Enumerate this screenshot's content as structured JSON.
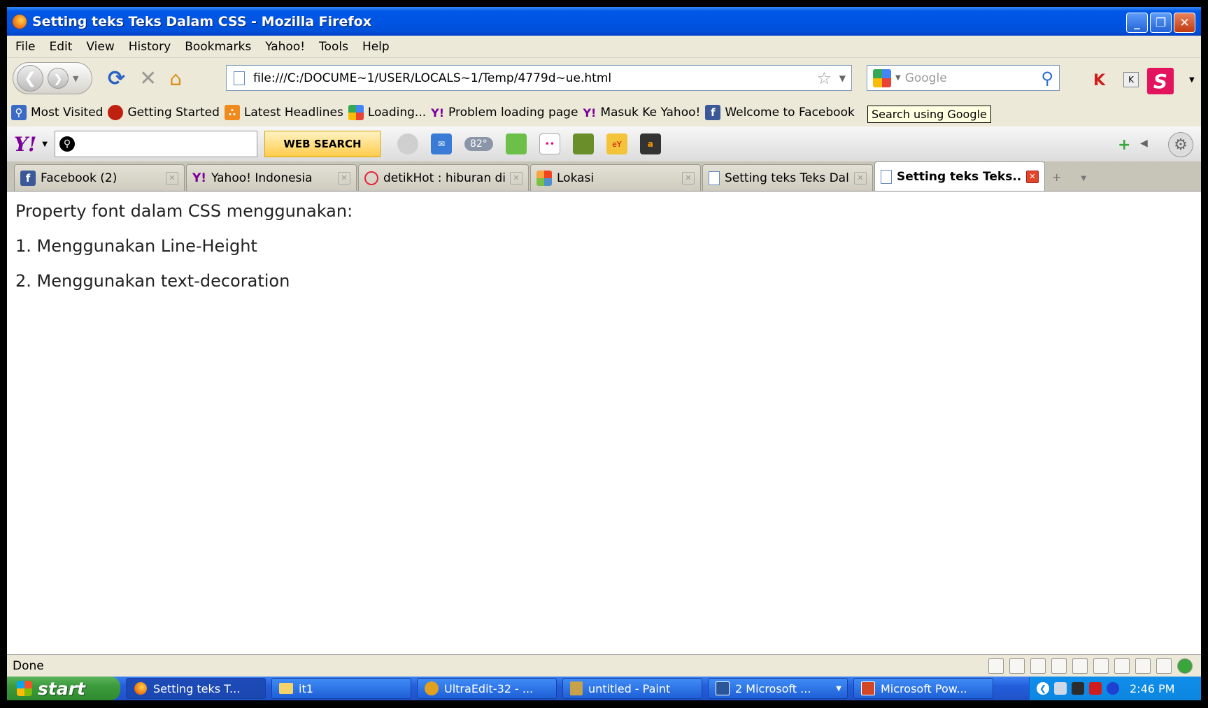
{
  "window": {
    "title": "Setting teks Teks Dalam CSS - Mozilla Firefox",
    "minimize": "_",
    "maximize": "❐",
    "close": "✕"
  },
  "menu": [
    "File",
    "Edit",
    "View",
    "History",
    "Bookmarks",
    "Yahoo!",
    "Tools",
    "Help"
  ],
  "nav": {
    "url": "file:///C:/DOCUME~1/USER/LOCALS~1/Temp/4779d~ue.html",
    "search_placeholder": "Google"
  },
  "bookmarks": [
    {
      "label": "Most Visited",
      "icon": "most-visited-icon",
      "color": "#3b6bc6"
    },
    {
      "label": "Getting Started",
      "icon": "firefox-red-icon",
      "color": "#c0200f"
    },
    {
      "label": "Latest Headlines",
      "icon": "rss-icon",
      "color": "#f08a1c"
    },
    {
      "label": "Loading...",
      "icon": "google-icon",
      "color": "#4285f4"
    },
    {
      "label": "Problem loading page",
      "icon": "yahoo-icon",
      "color": "#7b0099"
    },
    {
      "label": "Masuk Ke Yahoo!",
      "icon": "yahoo-icon",
      "color": "#7b0099"
    },
    {
      "label": "Welcome to Facebook",
      "icon": "facebook-icon",
      "color": "#3b5998"
    }
  ],
  "tooltip": "Search using Google",
  "yahoo_toolbar": {
    "logo": "Y!",
    "search_button": "WEB SEARCH",
    "weather": "82°"
  },
  "tabs": [
    {
      "label": "Facebook (2)",
      "icon": "facebook-icon",
      "active": false
    },
    {
      "label": "Yahoo! Indonesia",
      "icon": "yahoo-icon",
      "active": false
    },
    {
      "label": "detikHot : hiburan di...",
      "icon": "detik-icon",
      "active": false
    },
    {
      "label": "Lokasi",
      "icon": "joomla-icon",
      "active": false
    },
    {
      "label": "Setting teks Teks Dal...",
      "icon": "page-icon",
      "active": false
    },
    {
      "label": "Setting teks Teks...",
      "icon": "page-icon",
      "active": true
    }
  ],
  "content": {
    "lines": [
      "Property font dalam CSS menggunakan:",
      "1. Menggunakan Line-Height",
      "2. Menggunakan text-decoration"
    ]
  },
  "status": {
    "text": "Done"
  },
  "taskbar": {
    "start": "start",
    "items": [
      {
        "label": "Setting teks T...",
        "icon": "firefox-icon",
        "active": true
      },
      {
        "label": "it1",
        "icon": "folder-icon",
        "active": false
      },
      {
        "label": "UltraEdit-32 - ...",
        "icon": "ultraedit-icon",
        "active": false
      },
      {
        "label": "untitled - Paint",
        "icon": "paint-icon",
        "active": false
      },
      {
        "label": "2 Microsoft ...",
        "icon": "word-icon",
        "active": false
      },
      {
        "label": "Microsoft Pow...",
        "icon": "powerpoint-icon",
        "active": false
      }
    ],
    "clock": "2:46 PM"
  },
  "colors": {
    "titlebar": "#0054e3",
    "yahoo": "#7b0099",
    "facebook": "#3b5998",
    "taskbar": "#245edb",
    "start": "#3c9b3c"
  }
}
